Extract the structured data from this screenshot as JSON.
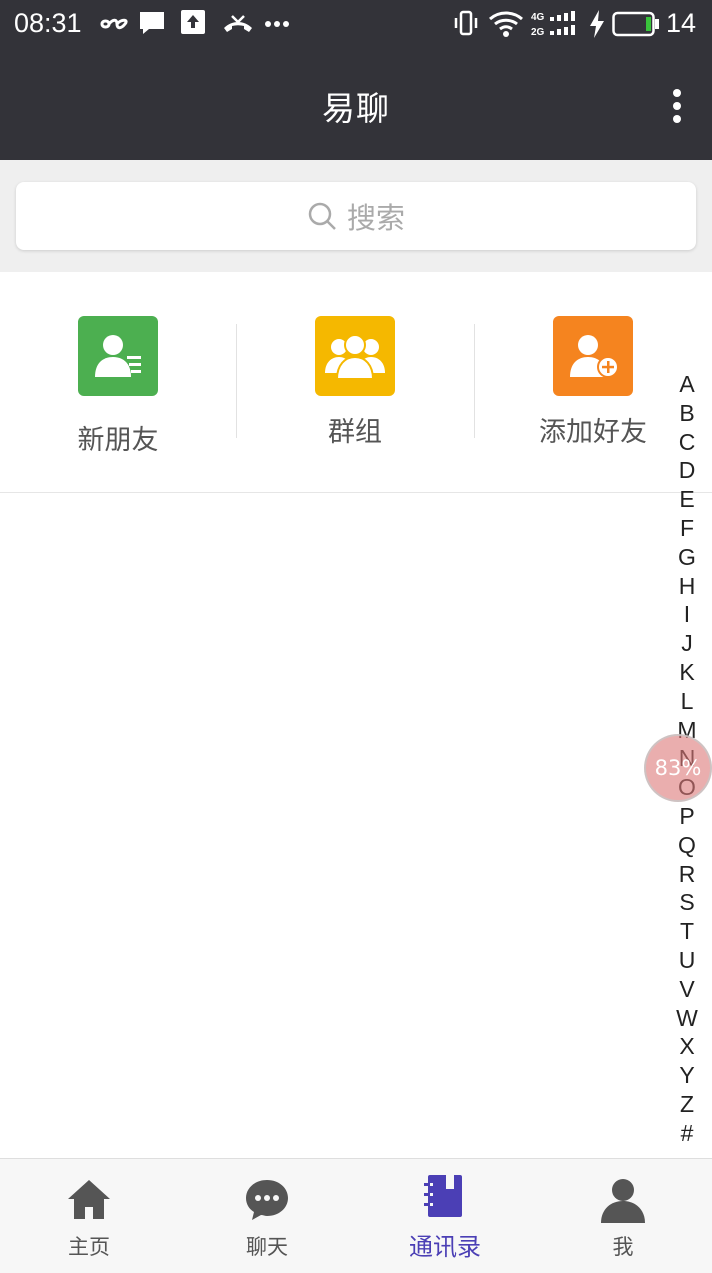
{
  "status_bar": {
    "time": "08:31",
    "battery_percent": "14",
    "icons": [
      "infinity-icon",
      "message-icon",
      "upload-icon",
      "missed-call-icon",
      "more-dots-icon",
      "vibrate-icon",
      "wifi-icon",
      "signal-icon",
      "charging-icon",
      "battery-icon"
    ]
  },
  "app_bar": {
    "title": "易聊",
    "menu_icon": "overflow-menu-icon"
  },
  "search": {
    "placeholder": "搜索",
    "icon": "search-icon"
  },
  "shortcuts": [
    {
      "label": "新朋友",
      "icon": "new-friend-icon",
      "color": "#4caf50"
    },
    {
      "label": "群组",
      "icon": "group-icon",
      "color": "#f5b800"
    },
    {
      "label": "添加好友",
      "icon": "add-friend-icon",
      "color": "#f5841f"
    }
  ],
  "index_letters": [
    "A",
    "B",
    "C",
    "D",
    "E",
    "F",
    "G",
    "H",
    "I",
    "J",
    "K",
    "L",
    "M",
    "N",
    "O",
    "P",
    "Q",
    "R",
    "S",
    "T",
    "U",
    "V",
    "W",
    "X",
    "Y",
    "Z",
    "#"
  ],
  "floating_badge": {
    "text": "83%"
  },
  "bottom_nav": {
    "items": [
      {
        "label": "主页",
        "icon": "home-icon",
        "active": false
      },
      {
        "label": "聊天",
        "icon": "chat-icon",
        "active": false
      },
      {
        "label": "通讯录",
        "icon": "contacts-icon",
        "active": true
      },
      {
        "label": "我",
        "icon": "profile-icon",
        "active": false
      }
    ],
    "active_color": "#4b3fb5",
    "inactive_color": "#555555"
  },
  "colors": {
    "header_bg": "#333339",
    "page_bg": "#efefef"
  }
}
